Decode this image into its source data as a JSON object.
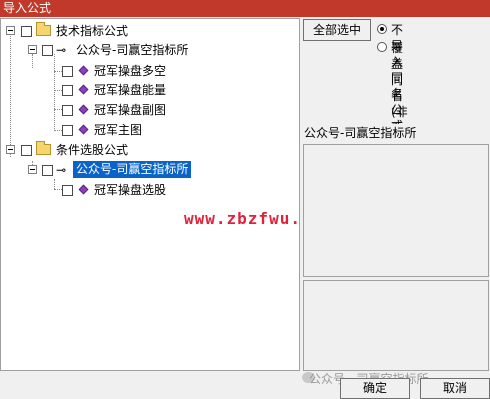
{
  "window": {
    "title": "导入公式"
  },
  "tree": {
    "groups": [
      {
        "label": "技术指标公式",
        "children": [
          {
            "label": "公众号-司赢空指标所",
            "items": [
              "冠军操盘多空",
              "冠军操盘能量",
              "冠军操盘副图",
              "冠军主图"
            ]
          }
        ]
      },
      {
        "label": "条件选股公式",
        "children": [
          {
            "label": "公众号-司赢空指标所",
            "items": [
              "冠军操盘选股"
            ]
          }
        ]
      }
    ]
  },
  "watermark": "www.zbzfwu.com",
  "options": {
    "select_all_label": "全部选中",
    "radios": [
      {
        "label": "不导入同名公式",
        "checked": true
      },
      {
        "label": "覆盖同名(非系统)",
        "checked": false
      }
    ]
  },
  "info": {
    "name": "公众号-司赢空指标所"
  },
  "footer": {
    "watermark": "公众号 · 司赢空指标所",
    "ok_label": "确定",
    "cancel_label": "取消"
  }
}
